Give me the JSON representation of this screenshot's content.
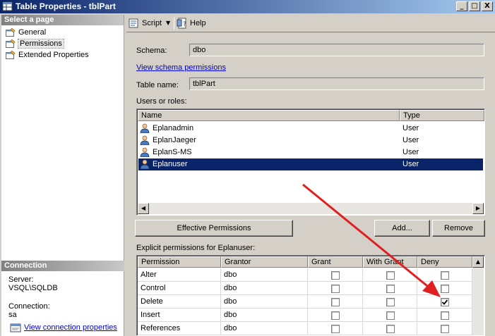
{
  "window": {
    "title": "Table Properties - tblPart",
    "controls": {
      "minimize": "_",
      "maximize": "□",
      "close": "X"
    }
  },
  "left_panel": {
    "header": "Select a page",
    "pages": [
      {
        "label": "General",
        "icon": "page-settings-icon",
        "selected": false
      },
      {
        "label": "Permissions",
        "icon": "page-settings-icon",
        "selected": true
      },
      {
        "label": "Extended Properties",
        "icon": "page-settings-icon",
        "selected": false
      }
    ],
    "connection": {
      "header": "Connection",
      "server_label": "Server:",
      "server_value": "VSQL\\SQLDB",
      "connection_label": "Connection:",
      "connection_value": "sa",
      "link": "View connection properties"
    }
  },
  "toolbar": {
    "script_label": "Script",
    "script_icon": "script-icon",
    "help_label": "Help",
    "help_icon": "help-icon"
  },
  "main": {
    "schema_label": "Schema:",
    "schema_value": "dbo",
    "view_schema_link": "View schema permissions",
    "table_name_label": "Table name:",
    "table_name_value": "tblPart",
    "users_label": "Users or roles:",
    "users_columns": [
      "Name",
      "Type"
    ],
    "users": [
      {
        "name": "Eplanadmin",
        "type": "User",
        "selected": false
      },
      {
        "name": "EplanJaeger",
        "type": "User",
        "selected": false
      },
      {
        "name": "EplanS-MS",
        "type": "User",
        "selected": false
      },
      {
        "name": "Eplanuser",
        "type": "User",
        "selected": true
      }
    ],
    "buttons": {
      "effective": "Effective Permissions",
      "add": "Add...",
      "remove": "Remove"
    },
    "explicit_label": "Explicit permissions for Eplanuser:",
    "perm_columns": [
      "Permission",
      "Grantor",
      "Grant",
      "With Grant",
      "Deny"
    ],
    "permissions": [
      {
        "permission": "Alter",
        "grantor": "dbo",
        "grant": false,
        "with_grant": false,
        "deny": false
      },
      {
        "permission": "Control",
        "grantor": "dbo",
        "grant": false,
        "with_grant": false,
        "deny": false
      },
      {
        "permission": "Delete",
        "grantor": "dbo",
        "grant": false,
        "with_grant": false,
        "deny": true
      },
      {
        "permission": "Insert",
        "grantor": "dbo",
        "grant": false,
        "with_grant": false,
        "deny": false
      },
      {
        "permission": "References",
        "grantor": "dbo",
        "grant": false,
        "with_grant": false,
        "deny": false
      }
    ]
  },
  "colors": {
    "title_start": "#0a246a",
    "title_end": "#a6caf0",
    "selection": "#0a246a",
    "link": "#0000cc",
    "annotation_arrow": "#e02020"
  }
}
